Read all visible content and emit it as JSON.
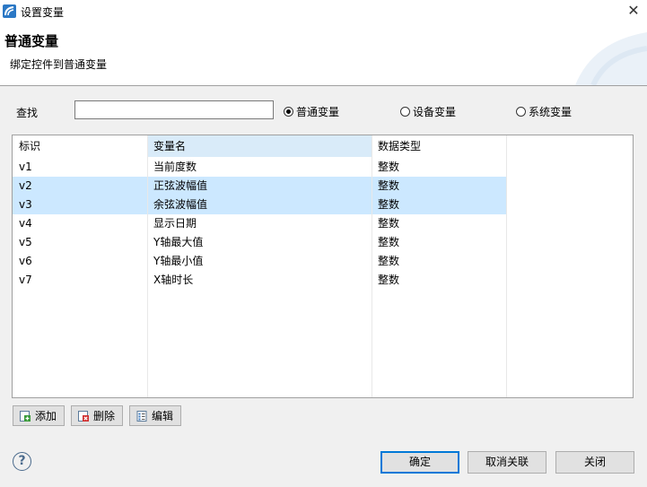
{
  "window": {
    "title": "设置变量",
    "close_glyph": "✕"
  },
  "header": {
    "title": "普通变量",
    "description": "绑定控件到普通变量"
  },
  "search": {
    "label": "查找",
    "value": "",
    "placeholder": ""
  },
  "radios": [
    {
      "label": "普通变量",
      "selected": true
    },
    {
      "label": "设备变量",
      "selected": false
    },
    {
      "label": "系统变量",
      "selected": false
    }
  ],
  "table": {
    "columns": [
      "标识",
      "变量名",
      "数据类型"
    ],
    "rows": [
      {
        "id": "v1",
        "name": "当前度数",
        "type": "整数",
        "selected": false
      },
      {
        "id": "v2",
        "name": "正弦波幅值",
        "type": "整数",
        "selected": true
      },
      {
        "id": "v3",
        "name": "余弦波幅值",
        "type": "整数",
        "selected": true
      },
      {
        "id": "v4",
        "name": "显示日期",
        "type": "整数",
        "selected": false
      },
      {
        "id": "v5",
        "name": "Y轴最大值",
        "type": "整数",
        "selected": false
      },
      {
        "id": "v6",
        "name": "Y轴最小值",
        "type": "整数",
        "selected": false
      },
      {
        "id": "v7",
        "name": "X轴时长",
        "type": "整数",
        "selected": false
      }
    ]
  },
  "toolbar": {
    "add_label": "添加",
    "delete_label": "删除",
    "edit_label": "编辑"
  },
  "help": {
    "glyph": "?"
  },
  "footer": {
    "ok_label": "确定",
    "unlink_label": "取消关联",
    "close_label": "关闭"
  },
  "colors": {
    "selection": "#cce8ff",
    "header_shade": "#d9ebf9",
    "focus": "#0078d7"
  },
  "icons": [
    "app-icon",
    "close-icon",
    "add-icon",
    "delete-icon",
    "edit-icon",
    "help-icon"
  ]
}
